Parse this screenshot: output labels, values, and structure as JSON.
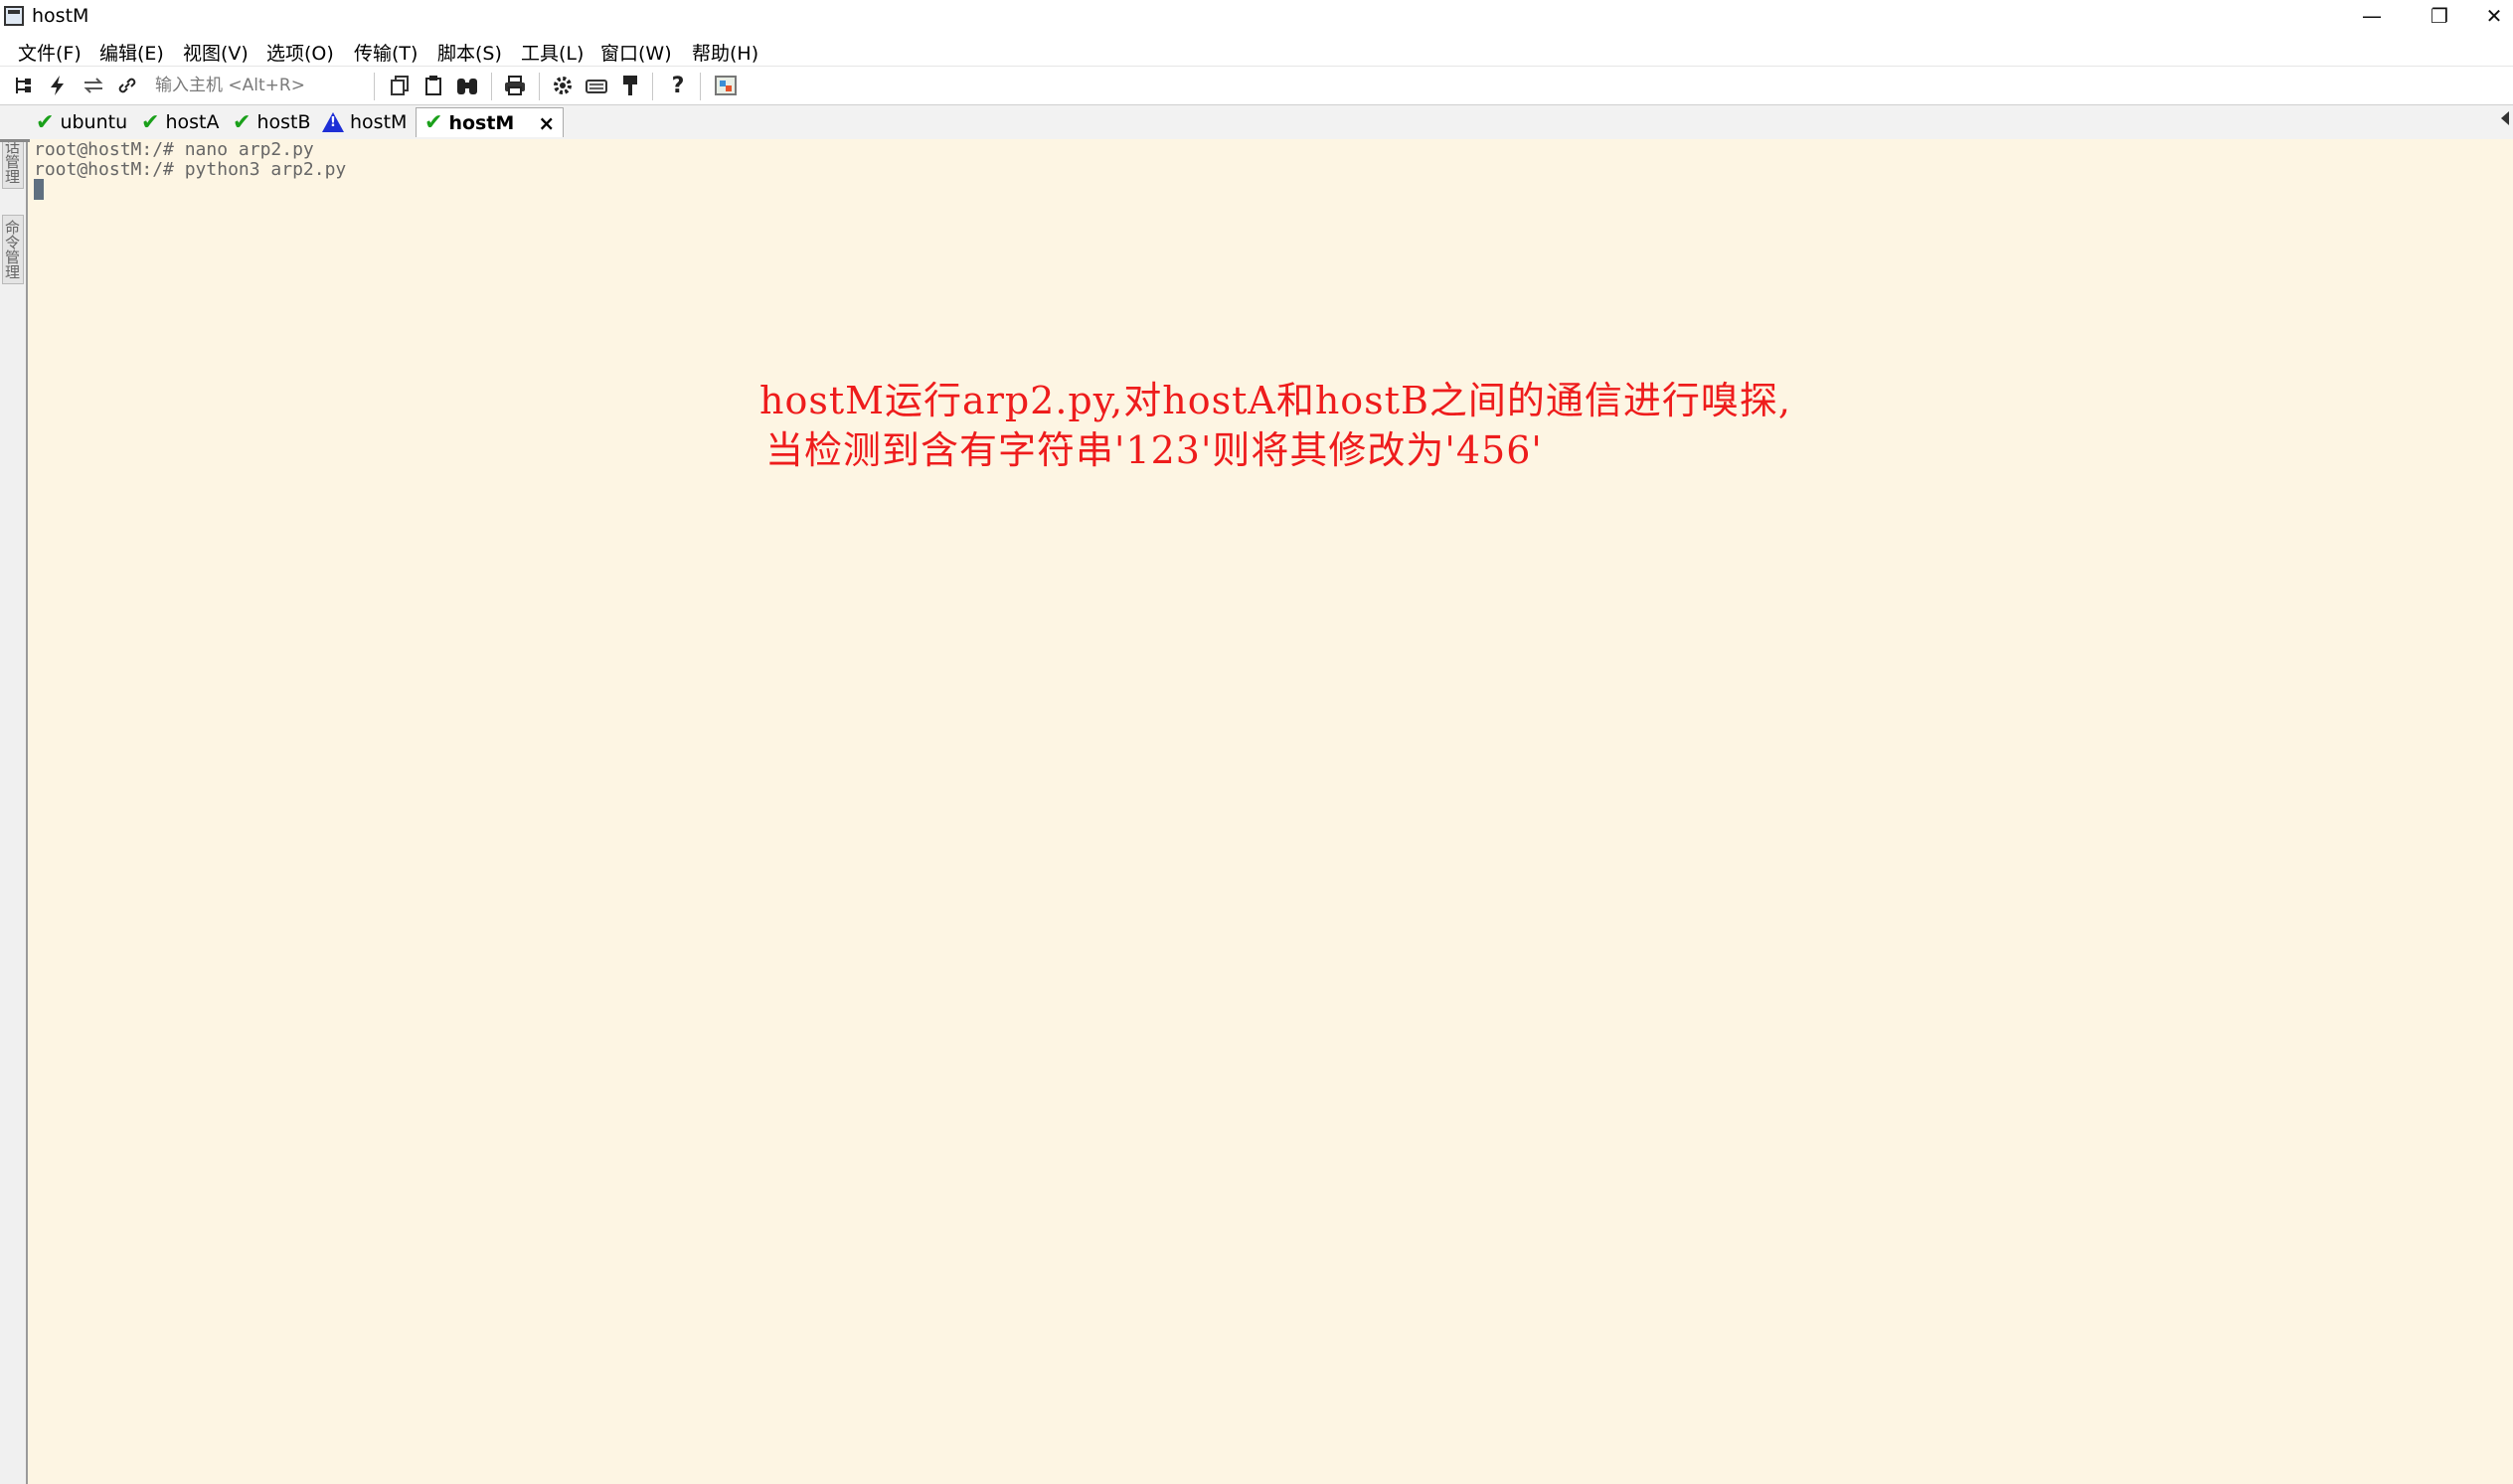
{
  "window": {
    "title": "hostM",
    "controls": [
      "—",
      "❐",
      "✕"
    ]
  },
  "menu": [
    "文件(F)",
    "编辑(E)",
    "视图(V)",
    "选项(O)",
    "传输(T)",
    "脚本(S)",
    "工具(L)",
    "窗口(W)",
    "帮助(H)"
  ],
  "toolbar": {
    "host_placeholder": "输入主机 <Alt+R>"
  },
  "side_tabs": [
    "会话管理",
    "命令管理"
  ],
  "tabs": [
    {
      "label": "ubuntu",
      "status": "connected"
    },
    {
      "label": "hostA",
      "status": "connected"
    },
    {
      "label": "hostB",
      "status": "connected"
    },
    {
      "label": "hostM",
      "status": "warning"
    },
    {
      "label": "hostM",
      "status": "connected",
      "active": true,
      "close": "×"
    }
  ],
  "terminal": {
    "lines": [
      "root@hostM:/# nano arp2.py",
      "root@hostM:/# python3 arp2.py"
    ]
  },
  "annotation": {
    "line1": "hostM运行arp2.py,对hostA和hostB之间的通信进行嗅探,",
    "line2": "当检测到含有字符串'123'则将其修改为'456'"
  },
  "colors": {
    "terminal_bg": "#fdf5e3",
    "annotation": "#ee1c1c",
    "check": "#1aa01a",
    "warning": "#1e2fd6"
  }
}
